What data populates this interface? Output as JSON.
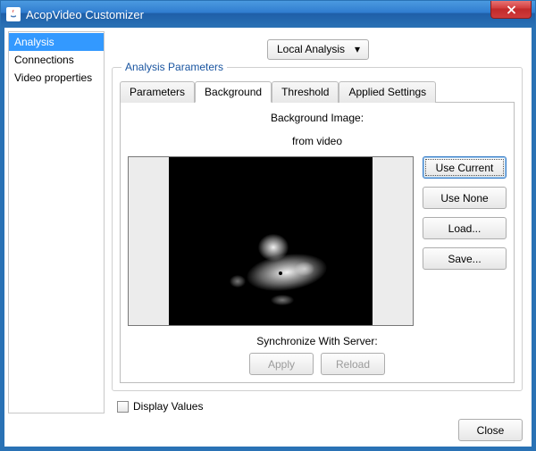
{
  "window": {
    "title": "AcopVideo Customizer"
  },
  "sidebar": {
    "items": [
      {
        "label": "Analysis",
        "selected": true
      },
      {
        "label": "Connections",
        "selected": false
      },
      {
        "label": "Video properties",
        "selected": false
      }
    ]
  },
  "analysis_mode": {
    "selected": "Local Analysis"
  },
  "group": {
    "title": "Analysis Parameters"
  },
  "tabs": {
    "items": [
      {
        "label": "Parameters",
        "active": false
      },
      {
        "label": "Background",
        "active": true
      },
      {
        "label": "Threshold",
        "active": false
      },
      {
        "label": "Applied Settings",
        "active": false
      }
    ]
  },
  "background": {
    "heading": "Background Image:",
    "source": "from video",
    "buttons": {
      "use_current": "Use Current",
      "use_none": "Use None",
      "load": "Load...",
      "save": "Save..."
    },
    "sync": {
      "heading": "Synchronize With Server:",
      "apply": "Apply",
      "reload": "Reload"
    }
  },
  "display_values": {
    "label": "Display Values",
    "checked": false
  },
  "footer": {
    "close": "Close"
  }
}
